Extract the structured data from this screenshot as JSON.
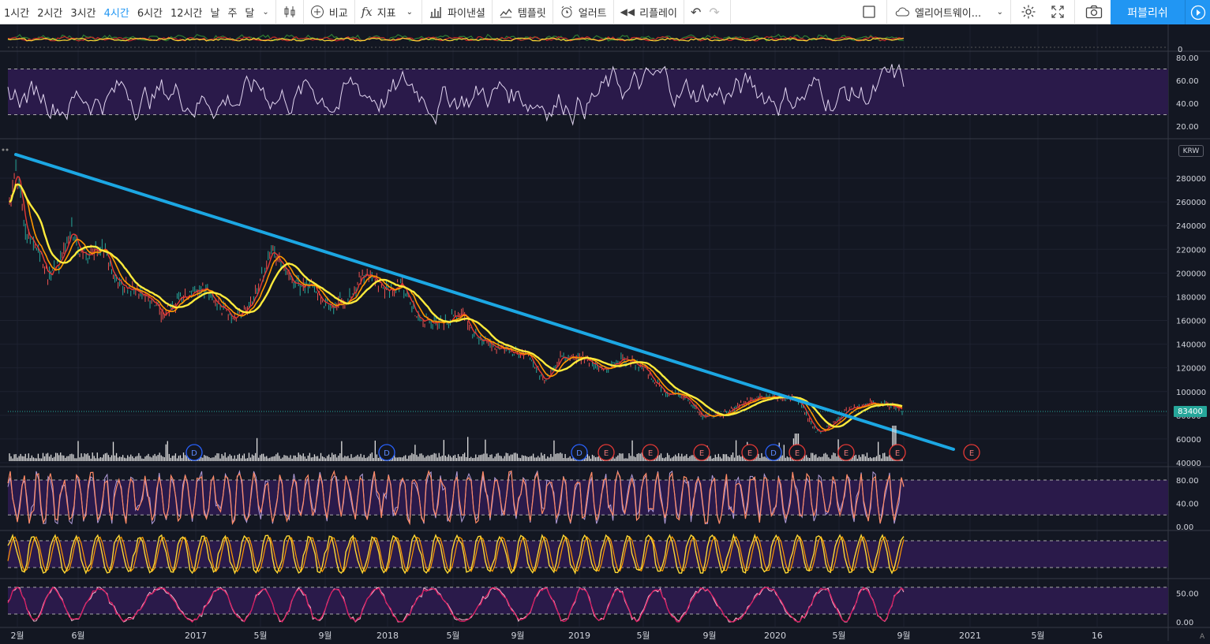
{
  "toolbar": {
    "intervals": [
      "1시간",
      "2시간",
      "3시간",
      "4시간",
      "6시간",
      "12시간",
      "날",
      "주",
      "달"
    ],
    "active_interval": "4시간",
    "compare_label": "비교",
    "indicators_label": "지표",
    "financials_label": "파이낸셜",
    "templates_label": "템플릿",
    "alert_label": "얼러트",
    "replay_label": "리플레이",
    "layout_name": "엘리어트웨이...",
    "publish_label": "퍼블리쉬"
  },
  "colors": {
    "background": "#131722",
    "trendline": "#1ca7e3",
    "ma_fast": "#e53935",
    "ma_mid": "#ff9800",
    "ma_slow": "#ffeb3b",
    "rsi_line": "#e1d5f0",
    "band_fill": "#2a1a4a",
    "last_price": "#26a69a"
  },
  "price_axis": {
    "currency": "KRW",
    "ticks": [
      "280000",
      "260000",
      "240000",
      "220000",
      "200000",
      "180000",
      "160000",
      "140000",
      "120000",
      "100000",
      "80000",
      "60000",
      "40000"
    ],
    "last_price": "83400"
  },
  "rsi_axis": {
    "ticks": [
      "80.00",
      "60.00",
      "40.00",
      "20.00"
    ]
  },
  "osc1_axis": {
    "ticks": [
      "80.00",
      "40.00",
      "0.00"
    ]
  },
  "osc3_axis": {
    "ticks": [
      "50.00",
      "0.00"
    ]
  },
  "top_axis": {
    "ticks": [
      "0"
    ]
  },
  "time_axis": {
    "labels": [
      "2월",
      "6월",
      "2017",
      "5월",
      "9월",
      "2018",
      "5월",
      "9월",
      "2019",
      "5월",
      "9월",
      "2020",
      "5월",
      "9월",
      "2021",
      "5월",
      "16"
    ]
  },
  "events": [
    "D",
    "D",
    "D",
    "E",
    "E",
    "E",
    "E",
    "D",
    "E",
    "E",
    "E",
    "E"
  ],
  "chart_data": {
    "type": "line",
    "title": "",
    "trendline": {
      "start": [
        "2016-02",
        300000
      ],
      "end": [
        "2020-12",
        52000
      ]
    },
    "last_price": 83400,
    "approx_closes": {
      "x": [
        "2016-02",
        "2016-04",
        "2016-06",
        "2016-09",
        "2016-12",
        "2017-03",
        "2017-05",
        "2017-08",
        "2017-11",
        "2018-01",
        "2018-04",
        "2018-07",
        "2018-10",
        "2019-01",
        "2019-04",
        "2019-07",
        "2019-09",
        "2019-12",
        "2020-03",
        "2020-05",
        "2020-08"
      ],
      "y": [
        270000,
        215000,
        225000,
        200000,
        175000,
        170000,
        220000,
        185000,
        170000,
        200000,
        180000,
        160000,
        130000,
        125000,
        125000,
        95000,
        80000,
        95000,
        65000,
        90000,
        86000
      ]
    }
  }
}
